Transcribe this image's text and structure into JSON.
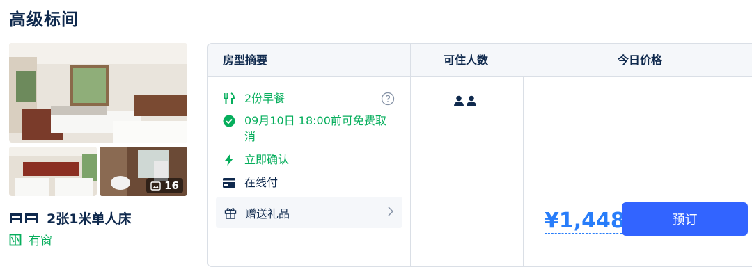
{
  "room": {
    "title": "高级标间",
    "photo_count": "16",
    "bed": "2张1米单人床",
    "window": "有窗"
  },
  "table": {
    "headers": {
      "summary": "房型摘要",
      "guests": "可住人数",
      "price": "今日价格"
    },
    "features": {
      "breakfast": "2份早餐",
      "cancel": "09月10日 18:00前可免费取消",
      "confirm": "立即确认",
      "payment": "在线付",
      "gift": "赠送礼品"
    },
    "price": "¥1,448",
    "book_label": "预订"
  },
  "colors": {
    "green": "#06ae5c",
    "blue": "#287dfa",
    "button": "#3264ff",
    "text": "#0f294d"
  }
}
